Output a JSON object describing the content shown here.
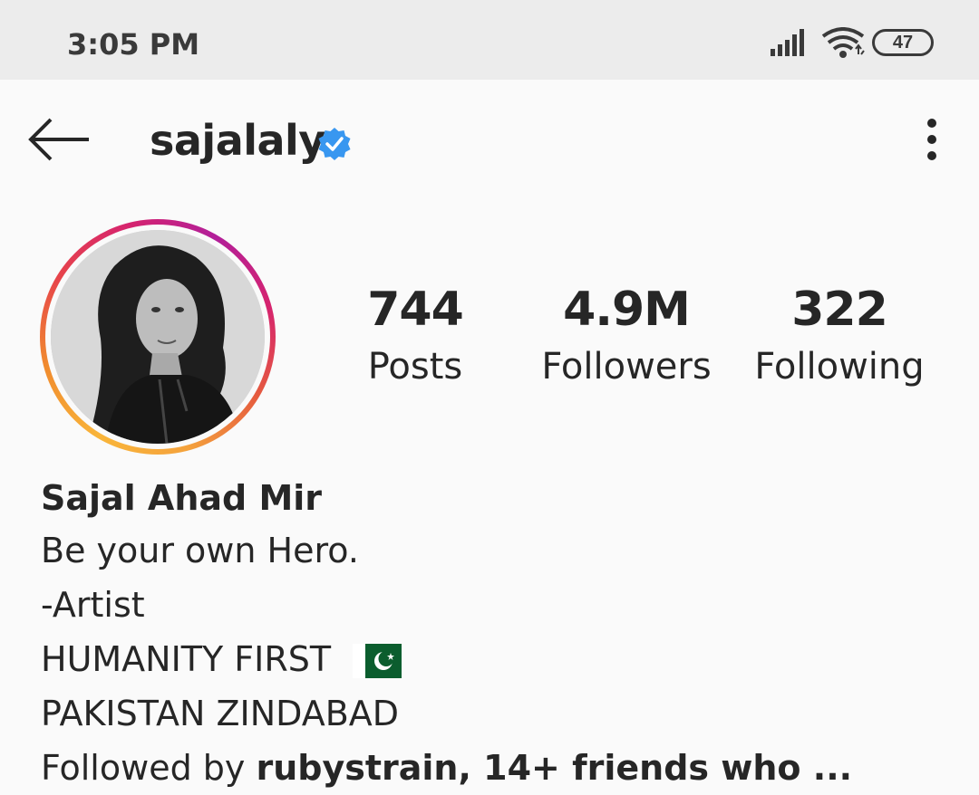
{
  "status_bar": {
    "time": "3:05 PM",
    "battery": "47",
    "icons": [
      "signal-icon",
      "wifi-icon",
      "battery-icon"
    ]
  },
  "header": {
    "username": "sajalaly",
    "verified": true,
    "icons": [
      "back-arrow-icon",
      "verified-badge-icon",
      "more-options-icon"
    ]
  },
  "stats": [
    {
      "value": "744",
      "label": "Posts"
    },
    {
      "value": "4.9M",
      "label": "Followers"
    },
    {
      "value": "322",
      "label": "Following"
    }
  ],
  "bio": {
    "name": "Sajal Ahad Mir",
    "lines": [
      "Be your own Hero.",
      "-Artist",
      "HUMANITY FIRST",
      "PAKISTAN ZINDABAD"
    ],
    "flag_icon": "pakistan-flag-icon",
    "followed_by_prefix": "Followed by ",
    "followed_by_names": "rubystrain, 14+ friends who ...",
    "followed_by_suffix": ""
  },
  "colors": {
    "accent_verified": "#3897f0",
    "ring_start": "#f9b53a",
    "ring_end": "#c13584"
  }
}
